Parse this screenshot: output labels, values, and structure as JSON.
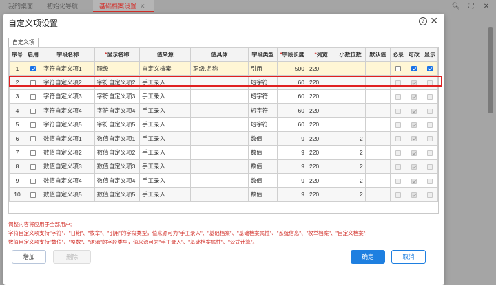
{
  "app_tabs": [
    {
      "label": "我的桌面"
    },
    {
      "label": "初始化导航"
    },
    {
      "label": "基础档案设置"
    }
  ],
  "dialog": {
    "title": "自定义项设置",
    "inner_tab": "自定义项"
  },
  "table": {
    "headers": {
      "seq": "序号",
      "enable": "启用",
      "field_name": "字段名称",
      "display_name": "显示名称",
      "value_source": "值来源",
      "value_specific": "值具体",
      "field_type": "字段类型",
      "field_length": "字段长度",
      "col_width": "列宽",
      "decimals": "小数位数",
      "default": "默认值",
      "required": "必录",
      "editable": "可改",
      "visible": "显示"
    },
    "rows": [
      {
        "seq": "1",
        "enabled": true,
        "field_name": "字符自定义项1",
        "display_name": "职级",
        "value_source": "自定义档案",
        "value_specific": "职级.名称",
        "field_type": "引用",
        "field_length": "500",
        "col_width": "220",
        "decimals": "",
        "default": "",
        "required": false,
        "editable": true,
        "visible": true
      },
      {
        "seq": "2",
        "enabled": false,
        "field_name": "字符自定义项2",
        "display_name": "字符自定义项2",
        "value_source": "手工录入",
        "value_specific": "",
        "field_type": "短字符",
        "field_length": "60",
        "col_width": "220",
        "decimals": "",
        "default": "",
        "required": false,
        "editable": true,
        "visible": false
      },
      {
        "seq": "3",
        "enabled": false,
        "field_name": "字符自定义项3",
        "display_name": "字符自定义项3",
        "value_source": "手工录入",
        "value_specific": "",
        "field_type": "短字符",
        "field_length": "60",
        "col_width": "220",
        "decimals": "",
        "default": "",
        "required": false,
        "editable": true,
        "visible": false
      },
      {
        "seq": "4",
        "enabled": false,
        "field_name": "字符自定义项4",
        "display_name": "字符自定义项4",
        "value_source": "手工录入",
        "value_specific": "",
        "field_type": "短字符",
        "field_length": "60",
        "col_width": "220",
        "decimals": "",
        "default": "",
        "required": false,
        "editable": true,
        "visible": false
      },
      {
        "seq": "5",
        "enabled": false,
        "field_name": "字符自定义项5",
        "display_name": "字符自定义项5",
        "value_source": "手工录入",
        "value_specific": "",
        "field_type": "短字符",
        "field_length": "60",
        "col_width": "220",
        "decimals": "",
        "default": "",
        "required": false,
        "editable": true,
        "visible": false
      },
      {
        "seq": "6",
        "enabled": false,
        "field_name": "数值自定义项1",
        "display_name": "数值自定义项1",
        "value_source": "手工录入",
        "value_specific": "",
        "field_type": "数值",
        "field_length": "9",
        "col_width": "220",
        "decimals": "2",
        "default": "",
        "required": false,
        "editable": true,
        "visible": false
      },
      {
        "seq": "7",
        "enabled": false,
        "field_name": "数值自定义项2",
        "display_name": "数值自定义项2",
        "value_source": "手工录入",
        "value_specific": "",
        "field_type": "数值",
        "field_length": "9",
        "col_width": "220",
        "decimals": "2",
        "default": "",
        "required": false,
        "editable": true,
        "visible": false
      },
      {
        "seq": "8",
        "enabled": false,
        "field_name": "数值自定义项3",
        "display_name": "数值自定义项3",
        "value_source": "手工录入",
        "value_specific": "",
        "field_type": "数值",
        "field_length": "9",
        "col_width": "220",
        "decimals": "2",
        "default": "",
        "required": false,
        "editable": true,
        "visible": false
      },
      {
        "seq": "9",
        "enabled": false,
        "field_name": "数值自定义项4",
        "display_name": "数值自定义项4",
        "value_source": "手工录入",
        "value_specific": "",
        "field_type": "数值",
        "field_length": "9",
        "col_width": "220",
        "decimals": "2",
        "default": "",
        "required": false,
        "editable": true,
        "visible": false
      },
      {
        "seq": "10",
        "enabled": false,
        "field_name": "数值自定义项5",
        "display_name": "数值自定义项5",
        "value_source": "手工录入",
        "value_specific": "",
        "field_type": "数值",
        "field_length": "9",
        "col_width": "220",
        "decimals": "2",
        "default": "",
        "required": false,
        "editable": true,
        "visible": false
      }
    ]
  },
  "notes": [
    "调整内容将应用于全部用户;",
    "字符自定义项支持\"字符\"、\"日期\"、\"枚举\"、\"引用\"的字段类型，值来源可为\"手工录入\"、\"基础档案\"、\"基础档案属性\"、\"系统信息\"、\"枚举档案\"、\"自定义档案\";",
    "数值自定义项支持\"数值\"、\"整数\"、\"逻辑\"的字段类型，值来源可为\"手工录入\"、\"基础档案属性\"、\"公式计算\"。"
  ],
  "buttons": {
    "add": "增加",
    "delete": "删除",
    "ok": "确定",
    "cancel": "取消"
  },
  "colors": {
    "accent": "#1e7fe0",
    "highlight": "#e02020",
    "active_tab": "#d2302a"
  }
}
